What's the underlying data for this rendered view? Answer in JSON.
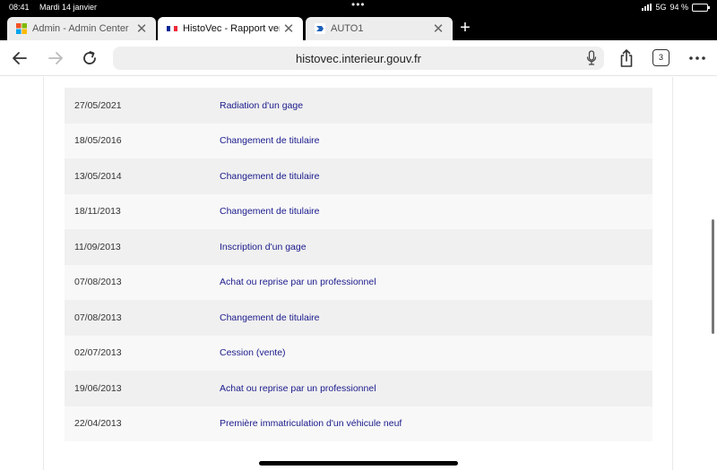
{
  "status_bar": {
    "time": "08:41",
    "date": "Mardi 14 janvier",
    "network": "5G",
    "battery": "94 %"
  },
  "tabs": [
    {
      "title": "Admin - Admin Center",
      "state": "inactive",
      "icon": "admin-center-icon"
    },
    {
      "title": "HistoVec - Rapport vendeur",
      "state": "active",
      "icon": "french-flag-icon"
    },
    {
      "title": "AUTO1",
      "state": "inactive",
      "icon": "auto1-icon"
    }
  ],
  "toolbar": {
    "url": "histovec.interieur.gouv.fr",
    "tab_count": "3"
  },
  "history": [
    {
      "date": "27/05/2021",
      "event": "Radiation d'un gage"
    },
    {
      "date": "18/05/2016",
      "event": "Changement de titulaire"
    },
    {
      "date": "13/05/2014",
      "event": "Changement de titulaire"
    },
    {
      "date": "18/11/2013",
      "event": "Changement de titulaire"
    },
    {
      "date": "11/09/2013",
      "event": "Inscription d'un gage"
    },
    {
      "date": "07/08/2013",
      "event": "Achat ou reprise par un professionnel"
    },
    {
      "date": "07/08/2013",
      "event": "Changement de titulaire"
    },
    {
      "date": "02/07/2013",
      "event": "Cession (vente)"
    },
    {
      "date": "19/06/2013",
      "event": "Achat ou reprise par un professionnel"
    },
    {
      "date": "22/04/2013",
      "event": "Première immatriculation d'un véhicule neuf"
    }
  ],
  "colors": {
    "event_link": "#1a1a8c",
    "row_odd": "#f0f0f0",
    "row_even": "#f8f8f8"
  }
}
